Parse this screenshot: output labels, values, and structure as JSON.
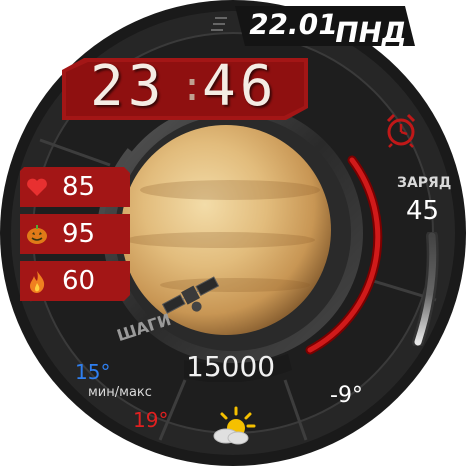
{
  "date": {
    "day_month": "22.01",
    "weekday": "ПНД"
  },
  "time": {
    "hours": "23",
    "separator": ":",
    "minutes": "46"
  },
  "stats": [
    {
      "icon": "heart-icon",
      "value": "85"
    },
    {
      "icon": "pumpkin-icon",
      "value": "95"
    },
    {
      "icon": "flame-icon",
      "value": "60"
    }
  ],
  "battery": {
    "label": "ЗАРЯД",
    "value": "45",
    "level_percent": 45
  },
  "steps": {
    "label": "ШАГИ",
    "value": "15000"
  },
  "weather": {
    "min_temp": "15°",
    "minmax_label": "мин/макс",
    "max_temp": "19°",
    "current_temp": "-9°",
    "icon": "partly-cloudy-icon"
  },
  "alarm": {
    "icon": "alarm-clock-icon"
  },
  "colors": {
    "accent_red": "#b01818",
    "min_temp_blue": "#2f7ff0",
    "max_temp_red": "#e02020",
    "bezel_dark": "#1c1c1c"
  }
}
